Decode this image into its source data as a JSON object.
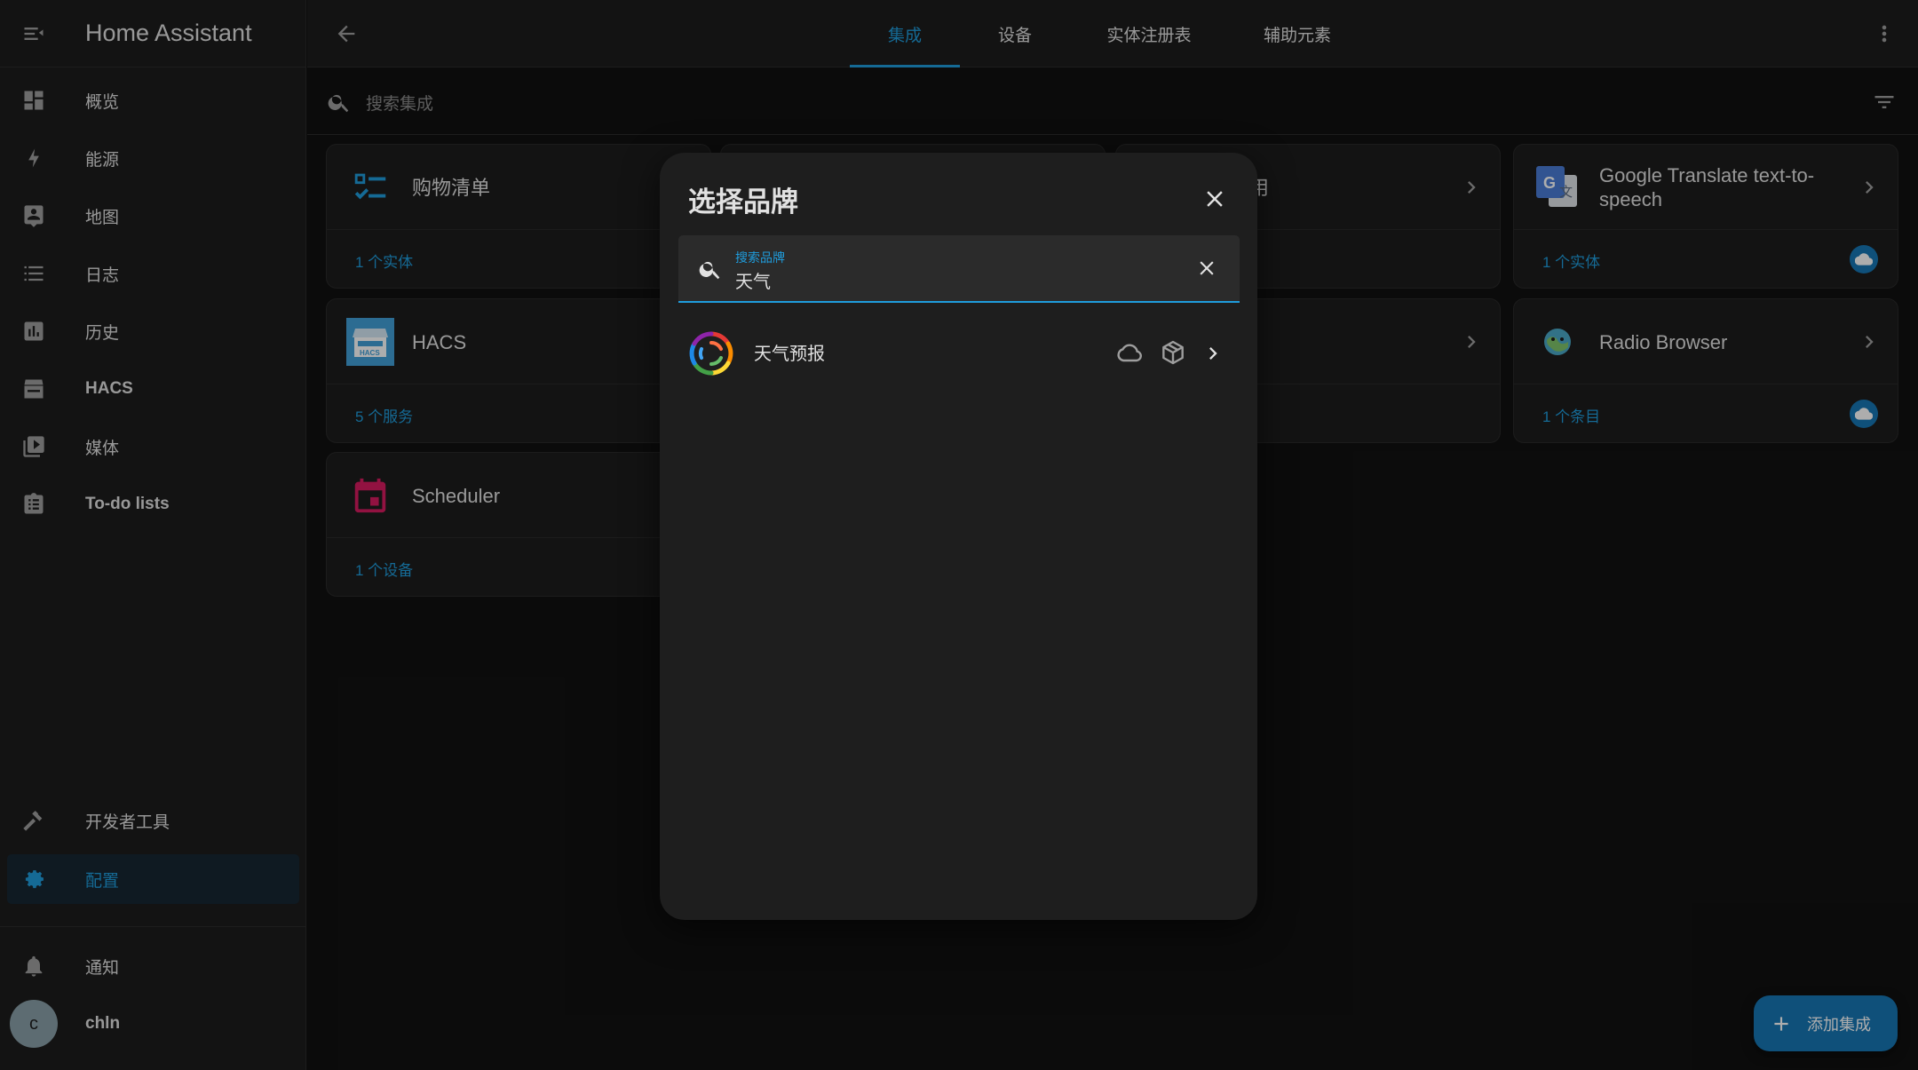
{
  "sidebar": {
    "title": "Home Assistant",
    "items": [
      {
        "label": "概览",
        "icon": "dashboard-icon"
      },
      {
        "label": "能源",
        "icon": "lightning-icon"
      },
      {
        "label": "地图",
        "icon": "map-account-icon"
      },
      {
        "label": "日志",
        "icon": "list-icon"
      },
      {
        "label": "历史",
        "icon": "chart-box-icon"
      },
      {
        "label": "HACS",
        "icon": "hacs-store-icon"
      },
      {
        "label": "媒体",
        "icon": "play-box-multiple-icon"
      },
      {
        "label": "To-do lists",
        "icon": "clipboard-list-icon"
      }
    ],
    "bottom_items": [
      {
        "label": "开发者工具",
        "icon": "hammer-icon"
      },
      {
        "label": "配置",
        "icon": "gear-icon"
      }
    ],
    "notifications_label": "通知",
    "user": {
      "initial": "c",
      "name": "chln"
    }
  },
  "tabs": [
    {
      "label": "集成",
      "active": true
    },
    {
      "label": "设备",
      "active": false
    },
    {
      "label": "实体注册表",
      "active": false
    },
    {
      "label": "辅助元素",
      "active": false
    }
  ],
  "search": {
    "placeholder": "搜索集成"
  },
  "cards": [
    {
      "name": "购物清单",
      "footer": "1 个实体",
      "icon": "shopping-list-icon"
    },
    {
      "name": "用",
      "footer": ""
    },
    {
      "name": "Google Translate text-to-speech",
      "footer": "1 个实体",
      "icon": "google-translate-icon",
      "badge": "cloud-icon"
    },
    {
      "name": "HACS",
      "footer": "5 个服务",
      "icon": "hacs-icon",
      "badge": "package-icon"
    },
    {
      "name": "Radio Browser",
      "footer": "1 个条目",
      "icon": "radio-browser-icon",
      "badge": "cloud-icon"
    },
    {
      "name": "Scheduler",
      "footer": "1 个设备",
      "icon": "calendar-icon"
    }
  ],
  "dialog": {
    "title": "选择品牌",
    "search_label": "搜索品牌",
    "search_value": "天气",
    "results": [
      {
        "name": "天气预报",
        "icon": "weather-forecast-logo"
      }
    ]
  },
  "fab": {
    "label": "添加集成"
  },
  "colors": {
    "accent": "#1f9cdc",
    "background": "#111111",
    "surface": "#1c1c1c",
    "hacs_badge": "#d4a017",
    "fab": "#1777b4"
  }
}
